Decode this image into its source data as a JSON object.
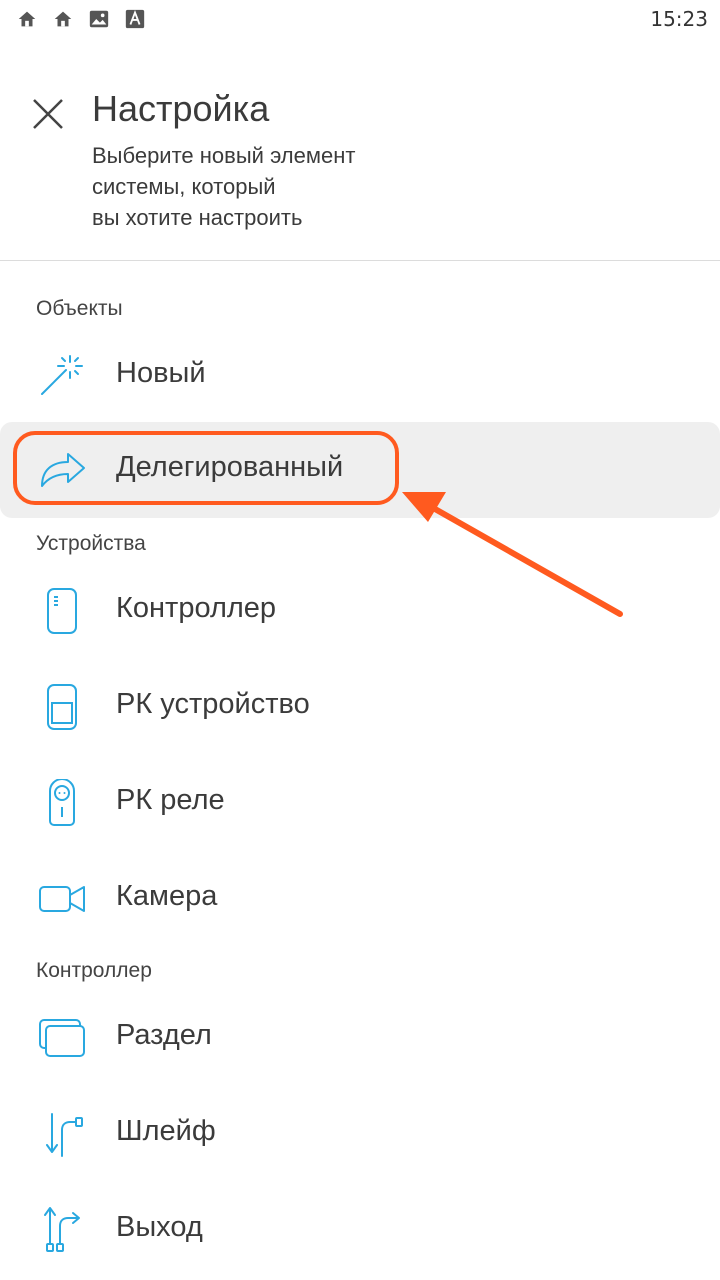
{
  "status_bar": {
    "time": "15:23",
    "icons": [
      "home-icon",
      "home-icon",
      "image-icon",
      "text-icon"
    ]
  },
  "header": {
    "close_icon": "close-icon",
    "title": "Настройка",
    "subtitle_lines": [
      "Выберите новый элемент",
      "системы, который",
      "вы хотите настроить"
    ]
  },
  "sections": [
    {
      "label": "Объекты",
      "items": [
        {
          "label": "Новый",
          "icon": "magic-wand-icon"
        },
        {
          "label": "Делегированный",
          "icon": "share-arrow-icon",
          "selected": true
        }
      ]
    },
    {
      "label": "Устройства",
      "items": [
        {
          "label": "Контроллер",
          "icon": "controller-icon"
        },
        {
          "label": "РК устройство",
          "icon": "rc-device-icon"
        },
        {
          "label": "РК реле",
          "icon": "rc-relay-icon"
        },
        {
          "label": "Камера",
          "icon": "camera-icon"
        }
      ]
    },
    {
      "label": "Контроллер",
      "items": [
        {
          "label": "Раздел",
          "icon": "partition-icon"
        },
        {
          "label": "Шлейф",
          "icon": "loop-icon"
        },
        {
          "label": "Выход",
          "icon": "output-icon"
        }
      ]
    }
  ],
  "colors": {
    "accent_icon": "#29a8e0",
    "highlight": "#ff5a1f",
    "selected_bg": "#efefef"
  }
}
